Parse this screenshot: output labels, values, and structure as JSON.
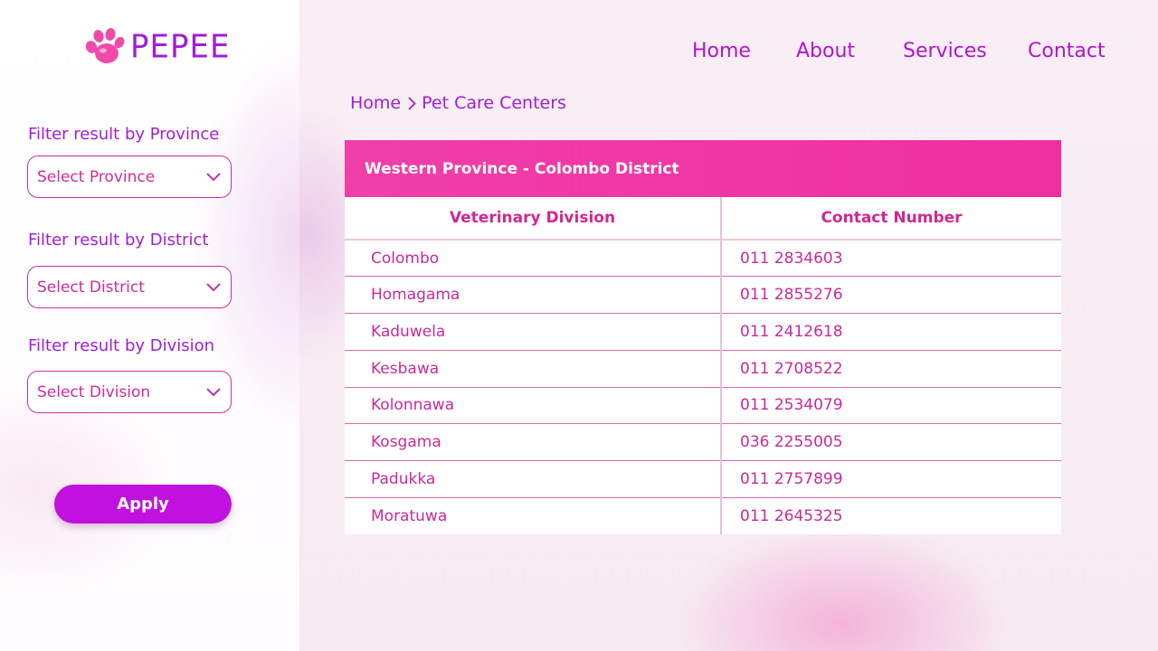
{
  "brand": {
    "name": "PEPEE",
    "logo_icon": "paw-icon",
    "logo_color": "#f04aa8"
  },
  "nav": [
    {
      "label": "Home"
    },
    {
      "label": "About"
    },
    {
      "label": "Services"
    },
    {
      "label": "Contact"
    }
  ],
  "breadcrumb": {
    "home": "Home",
    "separator_icon": "chevron-right-icon",
    "current": "Pet Care Centers"
  },
  "filters": {
    "province": {
      "label": "Filter result by Province",
      "value": "Select Province"
    },
    "district": {
      "label": "Filter result by District",
      "value": "Select District"
    },
    "division": {
      "label": "Filter result by Division",
      "value": "Select Division"
    },
    "apply_label": "Apply"
  },
  "table": {
    "title": "Western Province - Colombo District",
    "headers": [
      "Veterinary Division",
      "Contact Number"
    ],
    "rows": [
      [
        "Colombo",
        "011 2834603"
      ],
      [
        "Homagama",
        "011 2855276"
      ],
      [
        "Kaduwela",
        "011 2412618"
      ],
      [
        "Kesbawa",
        "011 2708522"
      ],
      [
        "Kolonnawa",
        "011 2534079"
      ],
      [
        "Kosgama",
        "036 2255005"
      ],
      [
        "Padukka",
        "011 2757899"
      ],
      [
        "Moratuwa",
        "011 2645325"
      ]
    ]
  },
  "colors": {
    "accent": "#a11dd8",
    "header_pink": "#ef36a4",
    "button": "#c111df",
    "text_pink": "#c92a98"
  }
}
